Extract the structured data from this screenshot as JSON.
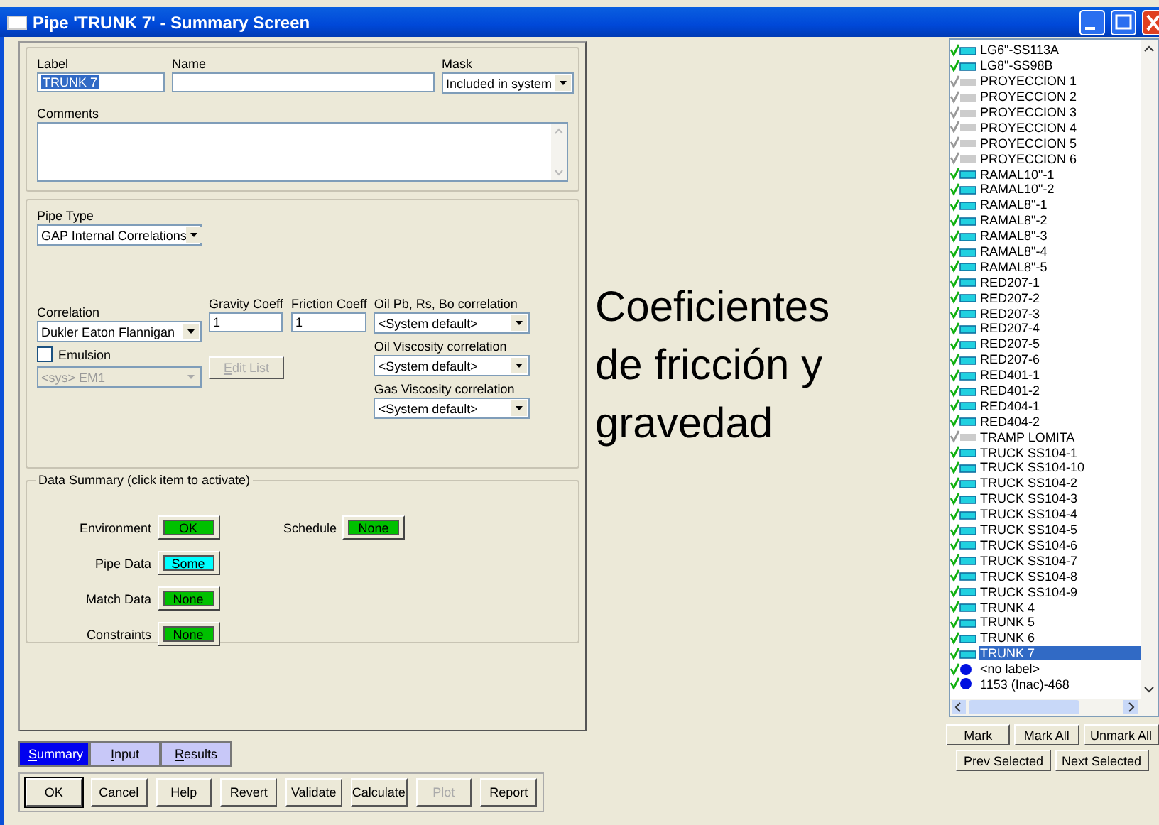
{
  "window": {
    "title": "Pipe 'TRUNK 7' - Summary Screen"
  },
  "header": {
    "label": {
      "caption": "Label",
      "value": "TRUNK 7"
    },
    "name": {
      "caption": "Name"
    },
    "mask": {
      "caption": "Mask",
      "value": "Included in system"
    },
    "comments": {
      "caption": "Comments"
    }
  },
  "pipe_type": {
    "caption": "Pipe Type",
    "value": "GAP Internal Correlations"
  },
  "correlation": {
    "caption": "Correlation",
    "value": "Dukler Eaton Flannigan"
  },
  "gravity_coeff": {
    "caption": "Gravity Coeff",
    "value": "1"
  },
  "friction_coeff": {
    "caption": "Friction Coeff",
    "value": "1"
  },
  "emulsion": {
    "label": "Emulsion",
    "checked": false,
    "select": "<sys> EM1",
    "disabled": true,
    "button": "Edit List"
  },
  "property_correlations": [
    {
      "caption": "Oil Pb, Rs, Bo correlation",
      "value": "<System default>"
    },
    {
      "caption": "Oil Viscosity correlation",
      "value": "<System default>"
    },
    {
      "caption": "Gas Viscosity correlation",
      "value": "<System default>"
    }
  ],
  "data_summary": {
    "title": "Data Summary (click item to activate)",
    "items": [
      {
        "label": "Environment",
        "status": "OK",
        "color": "#00c000"
      },
      {
        "label": "Pipe Data",
        "status": "Some",
        "color": "#00ffff"
      },
      {
        "label": "Match Data",
        "status": "None",
        "color": "#00c000"
      },
      {
        "label": "Constraints",
        "status": "None",
        "color": "#00c000"
      }
    ],
    "side_items": [
      {
        "label": "Schedule",
        "status": "None",
        "color": "#00c000"
      }
    ]
  },
  "annotation": "Coeficientes de fricción y gravedad",
  "tree": [
    {
      "label": "LG6\"-SS113A",
      "kind": "pipe",
      "selected": false
    },
    {
      "label": "LG8\"-SS98B",
      "kind": "pipe",
      "selected": false
    },
    {
      "label": "PROYECCION 1",
      "kind": "inactive",
      "selected": false
    },
    {
      "label": "PROYECCION 2",
      "kind": "inactive",
      "selected": false
    },
    {
      "label": "PROYECCION 3",
      "kind": "inactive",
      "selected": false
    },
    {
      "label": "PROYECCION 4",
      "kind": "inactive",
      "selected": false
    },
    {
      "label": "PROYECCION 5",
      "kind": "inactive",
      "selected": false
    },
    {
      "label": "PROYECCION 6",
      "kind": "inactive",
      "selected": false
    },
    {
      "label": "RAMAL10\"-1",
      "kind": "pipe",
      "selected": false
    },
    {
      "label": "RAMAL10\"-2",
      "kind": "pipe",
      "selected": false
    },
    {
      "label": "RAMAL8\"-1",
      "kind": "pipe",
      "selected": false
    },
    {
      "label": "RAMAL8\"-2",
      "kind": "pipe",
      "selected": false
    },
    {
      "label": "RAMAL8\"-3",
      "kind": "pipe",
      "selected": false
    },
    {
      "label": "RAMAL8\"-4",
      "kind": "pipe",
      "selected": false
    },
    {
      "label": "RAMAL8\"-5",
      "kind": "pipe",
      "selected": false
    },
    {
      "label": "RED207-1",
      "kind": "pipe",
      "selected": false
    },
    {
      "label": "RED207-2",
      "kind": "pipe",
      "selected": false
    },
    {
      "label": "RED207-3",
      "kind": "pipe",
      "selected": false
    },
    {
      "label": "RED207-4",
      "kind": "pipe",
      "selected": false
    },
    {
      "label": "RED207-5",
      "kind": "pipe",
      "selected": false
    },
    {
      "label": "RED207-6",
      "kind": "pipe",
      "selected": false
    },
    {
      "label": "RED401-1",
      "kind": "pipe",
      "selected": false
    },
    {
      "label": "RED401-2",
      "kind": "pipe",
      "selected": false
    },
    {
      "label": "RED404-1",
      "kind": "pipe",
      "selected": false
    },
    {
      "label": "RED404-2",
      "kind": "pipe",
      "selected": false
    },
    {
      "label": "TRAMP LOMITA",
      "kind": "inactive",
      "selected": false
    },
    {
      "label": "TRUCK SS104-1",
      "kind": "pipe",
      "selected": false
    },
    {
      "label": "TRUCK SS104-10",
      "kind": "pipe",
      "selected": false
    },
    {
      "label": "TRUCK SS104-2",
      "kind": "pipe",
      "selected": false
    },
    {
      "label": "TRUCK SS104-3",
      "kind": "pipe",
      "selected": false
    },
    {
      "label": "TRUCK SS104-4",
      "kind": "pipe",
      "selected": false
    },
    {
      "label": "TRUCK SS104-5",
      "kind": "pipe",
      "selected": false
    },
    {
      "label": "TRUCK SS104-6",
      "kind": "pipe",
      "selected": false
    },
    {
      "label": "TRUCK SS104-7",
      "kind": "pipe",
      "selected": false
    },
    {
      "label": "TRUCK SS104-8",
      "kind": "pipe",
      "selected": false
    },
    {
      "label": "TRUCK SS104-9",
      "kind": "pipe",
      "selected": false
    },
    {
      "label": "TRUNK 4",
      "kind": "pipe",
      "selected": false
    },
    {
      "label": "TRUNK 5",
      "kind": "pipe",
      "selected": false
    },
    {
      "label": "TRUNK 6",
      "kind": "pipe",
      "selected": false
    },
    {
      "label": "TRUNK 7",
      "kind": "pipe",
      "selected": true
    },
    {
      "label": "<no label>",
      "kind": "node",
      "selected": false
    },
    {
      "label": "1153 (Inac)-468",
      "kind": "node",
      "selected": false
    }
  ],
  "list_buttons": [
    "Mark",
    "Mark All",
    "Unmark All"
  ],
  "nav_buttons": [
    "Prev Selected",
    "Next Selected"
  ],
  "tabs": [
    {
      "label": "Summary",
      "selected": true
    },
    {
      "label": "Input",
      "selected": false
    },
    {
      "label": "Results",
      "selected": false
    }
  ],
  "buttons": [
    {
      "label": "OK",
      "disabled": false
    },
    {
      "label": "Cancel",
      "disabled": false
    },
    {
      "label": "Help",
      "disabled": false
    },
    {
      "label": "Revert",
      "disabled": false
    },
    {
      "label": "Validate",
      "disabled": false
    },
    {
      "label": "Calculate",
      "disabled": false
    },
    {
      "label": "Plot",
      "disabled": true
    },
    {
      "label": "Report",
      "disabled": false
    }
  ]
}
